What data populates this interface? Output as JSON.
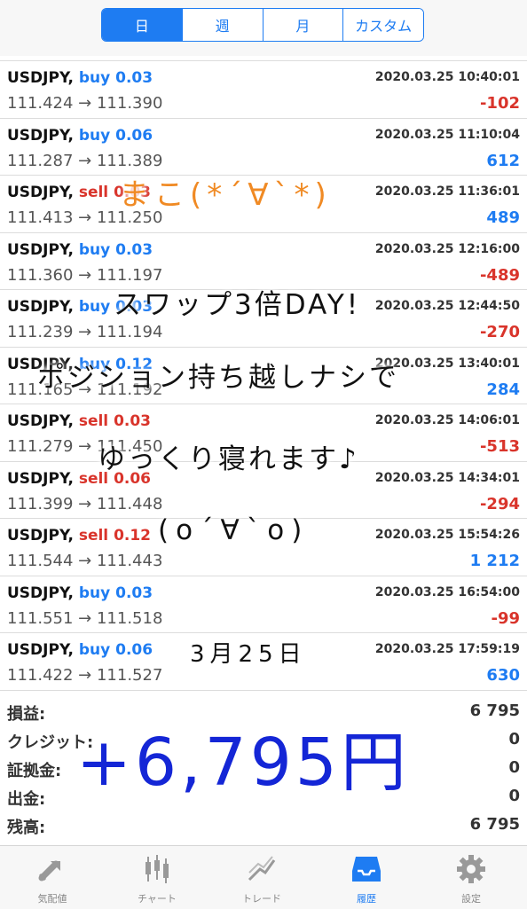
{
  "segments": [
    "日",
    "週",
    "月",
    "カスタム"
  ],
  "trades": [
    {
      "symbol": "USDJPY,",
      "side": "buy",
      "volume": "0.03",
      "prices": "111.424 → 111.390",
      "time": "2020.03.25 10:40:01",
      "profit": "-102"
    },
    {
      "symbol": "USDJPY,",
      "side": "buy",
      "volume": "0.06",
      "prices": "111.287 → 111.389",
      "time": "2020.03.25 11:10:04",
      "profit": "612"
    },
    {
      "symbol": "USDJPY,",
      "side": "sell",
      "volume": "0.03",
      "prices": "111.413 → 111.250",
      "time": "2020.03.25 11:36:01",
      "profit": "489"
    },
    {
      "symbol": "USDJPY,",
      "side": "buy",
      "volume": "0.03",
      "prices": "111.360 → 111.197",
      "time": "2020.03.25 12:16:00",
      "profit": "-489"
    },
    {
      "symbol": "USDJPY,",
      "side": "buy",
      "volume": "0.03",
      "prices": "111.239 → 111.194",
      "time": "2020.03.25 12:44:50",
      "profit": "-270"
    },
    {
      "symbol": "USDJPY,",
      "side": "buy",
      "volume": "0.12",
      "prices": "111.165 → 111.192",
      "time": "2020.03.25 13:40:01",
      "profit": "284"
    },
    {
      "symbol": "USDJPY,",
      "side": "sell",
      "volume": "0.03",
      "prices": "111.279 → 111.450",
      "time": "2020.03.25 14:06:01",
      "profit": "-513"
    },
    {
      "symbol": "USDJPY,",
      "side": "sell",
      "volume": "0.06",
      "prices": "111.399 → 111.448",
      "time": "2020.03.25 14:34:01",
      "profit": "-294"
    },
    {
      "symbol": "USDJPY,",
      "side": "sell",
      "volume": "0.12",
      "prices": "111.544 → 111.443",
      "time": "2020.03.25 15:54:26",
      "profit": "1 212"
    },
    {
      "symbol": "USDJPY,",
      "side": "buy",
      "volume": "0.03",
      "prices": "111.551 → 111.518",
      "time": "2020.03.25 16:54:00",
      "profit": "-99"
    },
    {
      "symbol": "USDJPY,",
      "side": "buy",
      "volume": "0.06",
      "prices": "111.422 → 111.527",
      "time": "2020.03.25 17:59:19",
      "profit": "630"
    }
  ],
  "summary": {
    "profit_label": "損益:",
    "profit_value": "6 795",
    "credit_label": "クレジット:",
    "credit_value": "0",
    "deposit_label": "証拠金:",
    "deposit_value": "0",
    "withdrawal_label": "出金:",
    "withdrawal_value": "0",
    "balance_label": "残高:",
    "balance_value": "6 795"
  },
  "tabs": [
    {
      "label": "気配値",
      "icon": "quotes-icon"
    },
    {
      "label": "チャート",
      "icon": "chart-icon"
    },
    {
      "label": "トレード",
      "icon": "trade-icon"
    },
    {
      "label": "履歴",
      "icon": "history-icon"
    },
    {
      "label": "設定",
      "icon": "settings-icon"
    }
  ],
  "colors": {
    "accent": "#1e7cf2",
    "negative": "#d9342b",
    "handwritten_total": "#1426d6",
    "handwritten_name": "#f08a24"
  },
  "handwritten": {
    "name": "まこ(*´∀`*)",
    "line1": "スワップ3倍DAY!",
    "line2": "ポジション持ち越しナシで",
    "line3": "ゆっくり寝れます♪",
    "line4": "(o´∀`o)",
    "date": "3月25日",
    "total": "+6,795円"
  }
}
